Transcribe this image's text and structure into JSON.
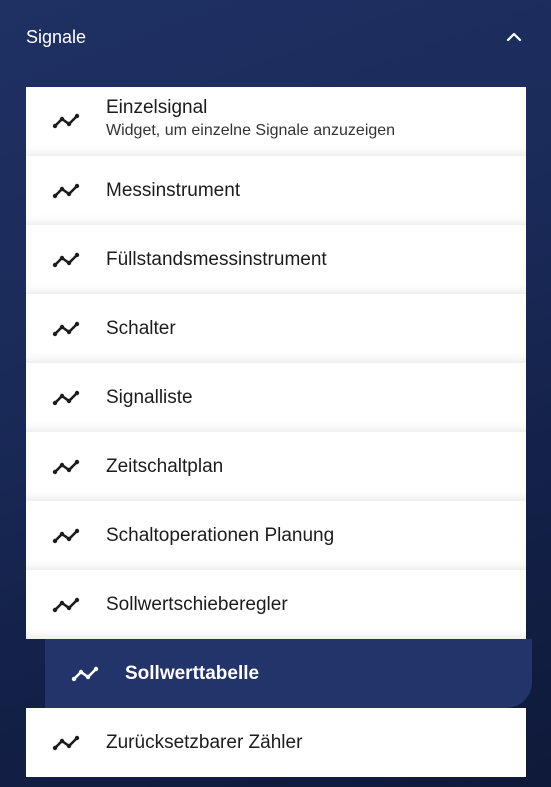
{
  "header": {
    "title": "Signale",
    "toggle_icon": "chevron-up-icon"
  },
  "colors": {
    "item_background": "#ffffff",
    "active_background": "#223469",
    "panel_background": "#1a2a58"
  },
  "items": [
    {
      "label": "Einzelsignal",
      "description": "Widget, um einzelne Signale anzuzeigen",
      "icon": "signal-line-icon"
    },
    {
      "label": "Messinstrument",
      "icon": "signal-line-icon"
    },
    {
      "label": "Füllstandsmessinstrument",
      "icon": "signal-line-icon"
    },
    {
      "label": "Schalter",
      "icon": "signal-line-icon"
    },
    {
      "label": "Signalliste",
      "icon": "signal-line-icon"
    },
    {
      "label": "Zeitschaltplan",
      "icon": "signal-line-icon"
    },
    {
      "label": "Schaltoperationen Planung",
      "icon": "signal-line-icon"
    },
    {
      "label": "Sollwertschieberegler",
      "icon": "signal-line-icon"
    },
    {
      "label": "Sollwerttabelle",
      "icon": "signal-line-icon",
      "selected": true
    },
    {
      "label": "Zurücksetzbarer Zähler",
      "icon": "signal-line-icon"
    }
  ]
}
